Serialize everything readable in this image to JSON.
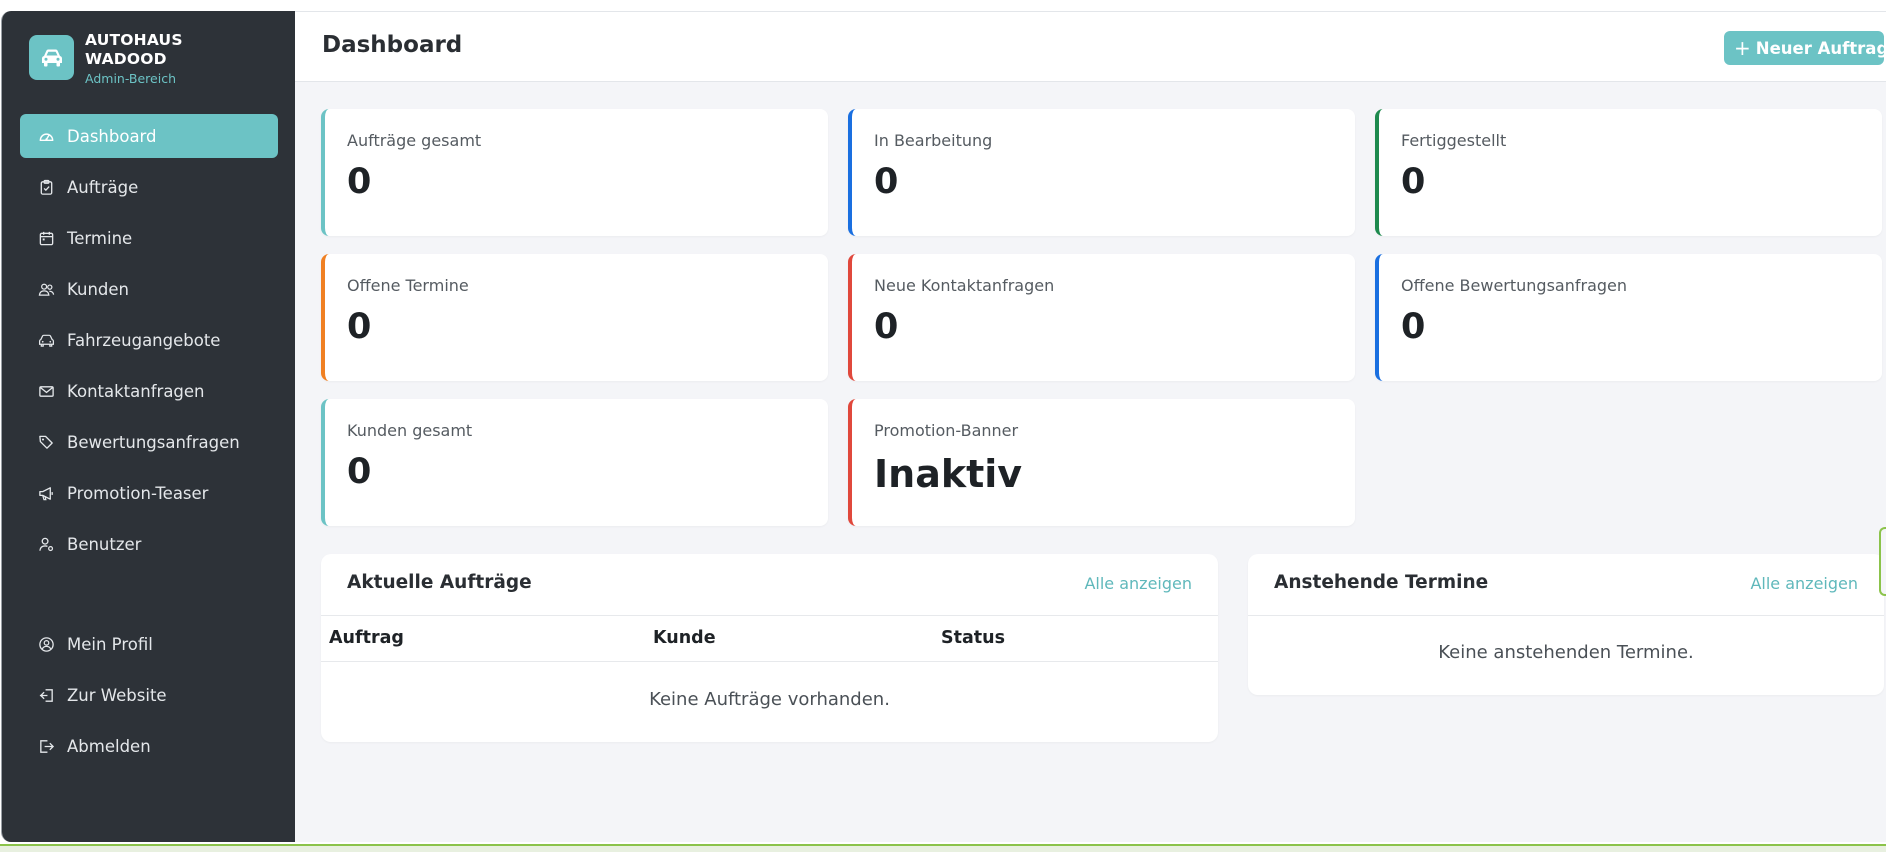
{
  "brand": {
    "name": "AUTOHAUS WADOOD",
    "subtitle": "Admin-Bereich",
    "logo_icon": "car-icon"
  },
  "sidebar": {
    "items": [
      {
        "label": "Dashboard",
        "icon": "dashboard-icon",
        "active": true
      },
      {
        "label": "Aufträge",
        "icon": "clipboard-icon"
      },
      {
        "label": "Termine",
        "icon": "calendar-icon"
      },
      {
        "label": "Kunden",
        "icon": "users-icon"
      },
      {
        "label": "Fahrzeugangebote",
        "icon": "car-icon"
      },
      {
        "label": "Kontaktanfragen",
        "icon": "envelope-icon"
      },
      {
        "label": "Bewertungsanfragen",
        "icon": "tags-icon"
      },
      {
        "label": "Promotion-Teaser",
        "icon": "megaphone-icon"
      },
      {
        "label": "Benutzer",
        "icon": "user-gear-icon"
      }
    ],
    "bottom_items": [
      {
        "label": "Mein Profil",
        "icon": "user-circle-icon"
      },
      {
        "label": "Zur Website",
        "icon": "sign-in-icon"
      },
      {
        "label": "Abmelden",
        "icon": "sign-out-icon"
      }
    ]
  },
  "header": {
    "title": "Dashboard",
    "new_button": "Neuer Auftrag"
  },
  "stats": [
    {
      "label": "Aufträge gesamt",
      "value": "0",
      "accent": "#6cc3c5"
    },
    {
      "label": "In Bearbeitung",
      "value": "0",
      "accent": "#1a6fe0"
    },
    {
      "label": "Fertiggestellt",
      "value": "0",
      "accent": "#1e8a4e"
    },
    {
      "label": "Offene Termine",
      "value": "0",
      "accent": "#f08022"
    },
    {
      "label": "Neue Kontaktanfragen",
      "value": "0",
      "accent": "#e0483c"
    },
    {
      "label": "Offene Bewertungsanfragen",
      "value": "0",
      "accent": "#1a6fe0"
    },
    {
      "label": "Kunden gesamt",
      "value": "0",
      "accent": "#6cc3c5"
    },
    {
      "label": "Promotion-Banner",
      "value": "Inaktiv",
      "accent": "#e0483c"
    }
  ],
  "orders_panel": {
    "title": "Aktuelle Aufträge",
    "link": "Alle anzeigen",
    "columns": [
      "Auftrag",
      "Kunde",
      "Status"
    ],
    "empty": "Keine Aufträge vorhanden."
  },
  "appointments_panel": {
    "title": "Anstehende Termine",
    "link": "Alle anzeigen",
    "empty": "Keine anstehenden Termine."
  }
}
